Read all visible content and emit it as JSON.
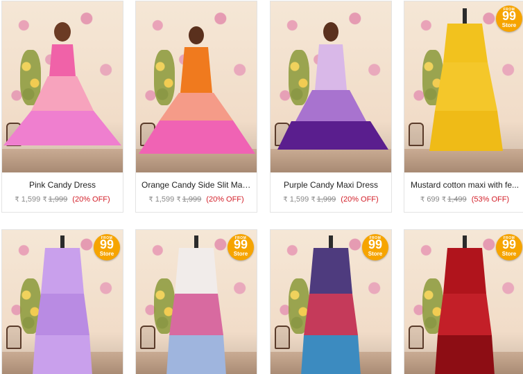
{
  "currency_symbol": "₹",
  "products_row1": [
    {
      "title": "Pink Candy Dress",
      "price": "1,599",
      "mrp": "1,999",
      "discount": "(20% OFF)",
      "colors": [
        "#f062a8",
        "#f7a3bd",
        "#ef7fcf"
      ]
    },
    {
      "title": "Orange Candy Side Slit Maxi ...",
      "price": "1,599",
      "mrp": "1,999",
      "discount": "(20% OFF)",
      "colors": [
        "#f07a1e",
        "#f59b88",
        "#f063b4"
      ]
    },
    {
      "title": "Purple Candy Maxi Dress",
      "price": "1,599",
      "mrp": "1,999",
      "discount": "(20% OFF)",
      "colors": [
        "#d9b8e8",
        "#a873cf",
        "#5a1e8e"
      ]
    },
    {
      "title": "Mustard cotton maxi with fe...",
      "price": "699",
      "mrp": "1,499",
      "discount": "(53% OFF)",
      "colors": [
        "#f2c21e",
        "#f4c72a",
        "#efbb17"
      ]
    }
  ],
  "products_row2": [
    {
      "colors": [
        "#c9a0ec",
        "#b98be3",
        "#c9a0ec"
      ]
    },
    {
      "colors": [
        "#f1ecea",
        "#d86aa0",
        "#9fb5de"
      ]
    },
    {
      "colors": [
        "#4e3b7e",
        "#c53a5a",
        "#3c8bc0"
      ]
    },
    {
      "colors": [
        "#b0141c",
        "#c31f28",
        "#8d0d14"
      ]
    }
  ],
  "badge": {
    "from": "FROM",
    "number": "99",
    "store": "Store"
  }
}
